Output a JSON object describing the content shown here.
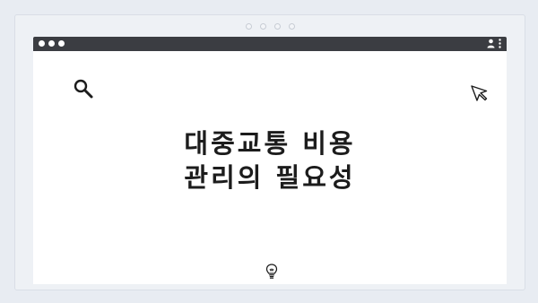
{
  "headline": {
    "line1": "대중교통 비용",
    "line2": "관리의 필요성"
  },
  "icons": {
    "search": "search-icon",
    "cursor": "cursor-icon",
    "lightbulb": "lightbulb-icon",
    "user": "user-icon",
    "menu": "kebab-menu-icon"
  },
  "colors": {
    "browser_bar": "#3b3d42",
    "page_background": "#e8ecf2",
    "content_background": "#ffffff",
    "text": "#1c1c1c"
  }
}
